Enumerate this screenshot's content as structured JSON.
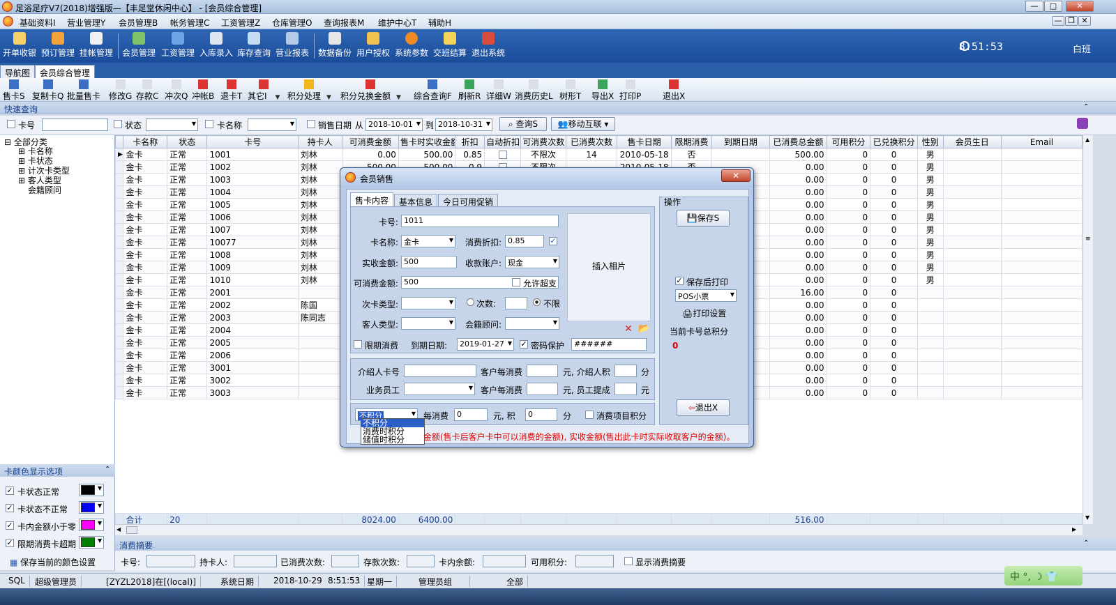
{
  "window": {
    "title": "足浴足疗V7(2018)增强版—【丰足堂休闲中心】 - [会员综合管理]"
  },
  "menu": [
    "基础资料I",
    "营业管理Y",
    "会员管理B",
    "帐务管理C",
    "工资管理Z",
    "仓库管理O",
    "查询报表M",
    "维护中心T",
    "辅助H"
  ],
  "toolbar": [
    {
      "label": "开单收银",
      "icon": "cashier-icon"
    },
    {
      "label": "预订管理",
      "icon": "booking-icon"
    },
    {
      "label": "挂帐管理",
      "icon": "credit-icon"
    },
    {
      "label": "会员管理",
      "icon": "member-icon"
    },
    {
      "label": "工资管理",
      "icon": "salary-icon"
    },
    {
      "label": "入库录入",
      "icon": "stock-in-icon"
    },
    {
      "label": "库存查询",
      "icon": "inventory-icon"
    },
    {
      "label": "营业报表",
      "icon": "report-icon"
    },
    {
      "label": "数据备份",
      "icon": "backup-icon"
    },
    {
      "label": "用户授权",
      "icon": "auth-icon"
    },
    {
      "label": "系统参数",
      "icon": "settings-icon"
    },
    {
      "label": "交班结算",
      "icon": "shift-icon"
    },
    {
      "label": "退出系统",
      "icon": "exit-icon"
    }
  ],
  "clock": "8:51:53",
  "shift": "白班",
  "tabs": [
    "导航图",
    "会员综合管理"
  ],
  "subtoolbar": [
    "售卡S",
    "复制卡Q",
    "批量售卡",
    "修改G",
    "存款C",
    "冲次Q",
    "冲帐B",
    "退卡T",
    "其它I",
    "积分处理",
    "积分兑换金额",
    "综合查询F",
    "刷新R",
    "详细W",
    "消费历史L",
    "树形T",
    "导出X",
    "打印P",
    "退出X"
  ],
  "quick_query": "快速查询",
  "filter": {
    "card_no": "卡号",
    "state": "状态",
    "card_name": "卡名称",
    "sale_date": "销售日期",
    "from": "从",
    "from_date": "2018-10-01",
    "to": "到",
    "to_date": "2018-10-31",
    "query": "查询S",
    "mobile": "移动互联"
  },
  "tree": [
    "全部分类",
    "卡名称",
    "卡状态",
    "计次卡类型",
    "客人类型",
    "会籍顾问"
  ],
  "color_panel": {
    "title": "卡颜色显示选项",
    "items": [
      {
        "label": "卡状态正常",
        "color": "#000000"
      },
      {
        "label": "卡状态不正常",
        "color": "#0000ff"
      },
      {
        "label": "卡内金额小于零",
        "color": "#ff00ff"
      },
      {
        "label": "限期消费卡超期",
        "color": "#008000"
      }
    ],
    "save": "保存当前的颜色设置"
  },
  "grid": {
    "columns": [
      "卡名称",
      "状态",
      "卡号",
      "持卡人",
      "可消费金额",
      "售卡时实收金额",
      "折扣",
      "自动折扣",
      "可消费次数",
      "已消费次数",
      "售卡日期",
      "限期消费",
      "到期日期",
      "已消费总金额",
      "可用积分",
      "已兑换积分",
      "性别",
      "会员生日",
      "Email"
    ],
    "rows": [
      [
        "金卡",
        "正常",
        "1001",
        "刘林",
        "0.00",
        "500.00",
        "0.85",
        "",
        "不限次",
        "14",
        "2010-05-18",
        "否",
        "",
        "500.00",
        "0",
        "0",
        "男",
        "",
        ""
      ],
      [
        "金卡",
        "正常",
        "1002",
        "刘林",
        "500.00",
        "500.00",
        "0.9",
        "",
        "不限次",
        "",
        "2010-05-18",
        "否",
        "",
        "0.00",
        "0",
        "0",
        "男",
        "",
        ""
      ],
      [
        "金卡",
        "正常",
        "1003",
        "刘林",
        "",
        "",
        "",
        "",
        "",
        "",
        "",
        "",
        "",
        "0.00",
        "0",
        "0",
        "男",
        "",
        ""
      ],
      [
        "金卡",
        "正常",
        "1004",
        "刘林",
        "",
        "",
        "",
        "",
        "",
        "",
        "",
        "",
        "",
        "0.00",
        "0",
        "0",
        "男",
        "",
        ""
      ],
      [
        "金卡",
        "正常",
        "1005",
        "刘林",
        "",
        "",
        "",
        "",
        "",
        "",
        "",
        "",
        "",
        "0.00",
        "0",
        "0",
        "男",
        "",
        ""
      ],
      [
        "金卡",
        "正常",
        "1006",
        "刘林",
        "",
        "",
        "",
        "",
        "",
        "",
        "",
        "",
        "",
        "0.00",
        "0",
        "0",
        "男",
        "",
        ""
      ],
      [
        "金卡",
        "正常",
        "1007",
        "刘林",
        "",
        "",
        "",
        "",
        "",
        "",
        "",
        "",
        "",
        "0.00",
        "0",
        "0",
        "男",
        "",
        ""
      ],
      [
        "金卡",
        "正常",
        "10077",
        "刘林",
        "",
        "",
        "",
        "",
        "",
        "",
        "",
        "",
        "",
        "0.00",
        "0",
        "0",
        "男",
        "",
        ""
      ],
      [
        "金卡",
        "正常",
        "1008",
        "刘林",
        "",
        "",
        "",
        "",
        "",
        "",
        "",
        "",
        "",
        "0.00",
        "0",
        "0",
        "男",
        "",
        ""
      ],
      [
        "金卡",
        "正常",
        "1009",
        "刘林",
        "",
        "",
        "",
        "",
        "",
        "",
        "",
        "",
        "",
        "0.00",
        "0",
        "0",
        "男",
        "",
        ""
      ],
      [
        "金卡",
        "正常",
        "1010",
        "刘林",
        "",
        "",
        "",
        "",
        "",
        "",
        "",
        "",
        "",
        "0.00",
        "0",
        "0",
        "男",
        "",
        ""
      ],
      [
        "金卡",
        "正常",
        "2001",
        "",
        "",
        "",
        "",
        "",
        "",
        "",
        "",
        "",
        "",
        "16.00",
        "0",
        "0",
        "",
        "",
        ""
      ],
      [
        "金卡",
        "正常",
        "2002",
        "陈国",
        "",
        "",
        "",
        "",
        "",
        "",
        "",
        "",
        "",
        "0.00",
        "0",
        "0",
        "",
        "",
        ""
      ],
      [
        "金卡",
        "正常",
        "2003",
        "陈同志",
        "",
        "",
        "",
        "",
        "",
        "",
        "",
        "",
        "",
        "0.00",
        "0",
        "0",
        "",
        "",
        ""
      ],
      [
        "金卡",
        "正常",
        "2004",
        "",
        "",
        "",
        "",
        "",
        "",
        "",
        "",
        "",
        "",
        "0.00",
        "0",
        "0",
        "",
        "",
        ""
      ],
      [
        "金卡",
        "正常",
        "2005",
        "",
        "",
        "",
        "",
        "",
        "",
        "",
        "",
        "",
        "",
        "0.00",
        "0",
        "0",
        "",
        "",
        ""
      ],
      [
        "金卡",
        "正常",
        "2006",
        "",
        "",
        "",
        "",
        "",
        "",
        "",
        "",
        "",
        "",
        "0.00",
        "0",
        "0",
        "",
        "",
        ""
      ],
      [
        "金卡",
        "正常",
        "3001",
        "",
        "",
        "",
        "",
        "",
        "",
        "",
        "",
        "",
        "",
        "0.00",
        "0",
        "0",
        "",
        "",
        ""
      ],
      [
        "金卡",
        "正常",
        "3002",
        "",
        "",
        "",
        "",
        "",
        "",
        "",
        "",
        "",
        "",
        "0.00",
        "0",
        "0",
        "",
        "",
        ""
      ],
      [
        "金卡",
        "正常",
        "3003",
        "",
        "",
        "",
        "",
        "",
        "",
        "",
        "",
        "",
        "",
        "0.00",
        "0",
        "0",
        "",
        "",
        ""
      ]
    ],
    "total": {
      "label": "合计",
      "count": "20",
      "balance": "8024.00",
      "received": "6400.00",
      "spent": "516.00"
    }
  },
  "summary": {
    "title": "消费摘要",
    "card_no": "卡号:",
    "holder": "持卡人:",
    "used_times": "已消费次数:",
    "deposit_times": "存款次数:",
    "balance": "卡内余额:",
    "points": "可用积分:",
    "show": "显示消费摘要"
  },
  "status": {
    "sql": "SQL",
    "user": "超级管理员",
    "db": "[ZYZL2018]在[(local)]",
    "sys_date_label": "系统日期",
    "sys_date": "2018-10-29",
    "time": "8:51:53",
    "weekday": "星期一",
    "group": "管理员组",
    "scope": "全部"
  },
  "ime": "中 °, ☽ 👕",
  "dialog": {
    "title": "会员销售",
    "tabs": [
      "售卡内容",
      "基本信息",
      "今日可用促销"
    ],
    "card_no_label": "卡号:",
    "card_no": "1011",
    "card_name_label": "卡名称:",
    "card_name": "金卡",
    "discount_label": "消费折扣:",
    "discount": "0.85",
    "paid_label": "实收金额:",
    "paid": "500",
    "account_label": "收款账户:",
    "account": "现金",
    "spendable_label": "可消费金额:",
    "spendable": "500",
    "overdraft": "允许超支",
    "times_type_label": "次卡类型:",
    "times_label": "次数:",
    "unlimited": "不限",
    "guest_type_label": "客人类型:",
    "advisor_label": "会籍顾问:",
    "limit_label": "限期消费",
    "expiry_label": "到期日期:",
    "expiry": "2019-01-27",
    "pwd_label": "密码保护",
    "pwd": "######",
    "photo": "插入相片",
    "referrer_label": "介绍人卡号",
    "per_spend": "客户每消费",
    "yuan_ref": "元, 介绍人积",
    "fen": "分",
    "staff_label": "业务员工",
    "yuan_staff": "元, 员工提成",
    "yuan": "元",
    "points_mode": "不积分",
    "every": "每消费",
    "every_value": "0",
    "yuan_ji": "元, 积",
    "points_value": "0",
    "item_points": "消费项目积分",
    "points_options": [
      "不积分",
      "消费时积分",
      "储值时积分"
    ],
    "note": "金额(售卡后客户卡中可以消费的金额), 实收金额(售出此卡时实际收取客户的金额)。",
    "op_title": "操作",
    "save": "保存S",
    "print_after": "保存后打印",
    "print_type": "POS小票",
    "print_setup": "打印设置",
    "total_points_label": "当前卡号总积分",
    "total_points": "0",
    "exit": "退出X"
  }
}
